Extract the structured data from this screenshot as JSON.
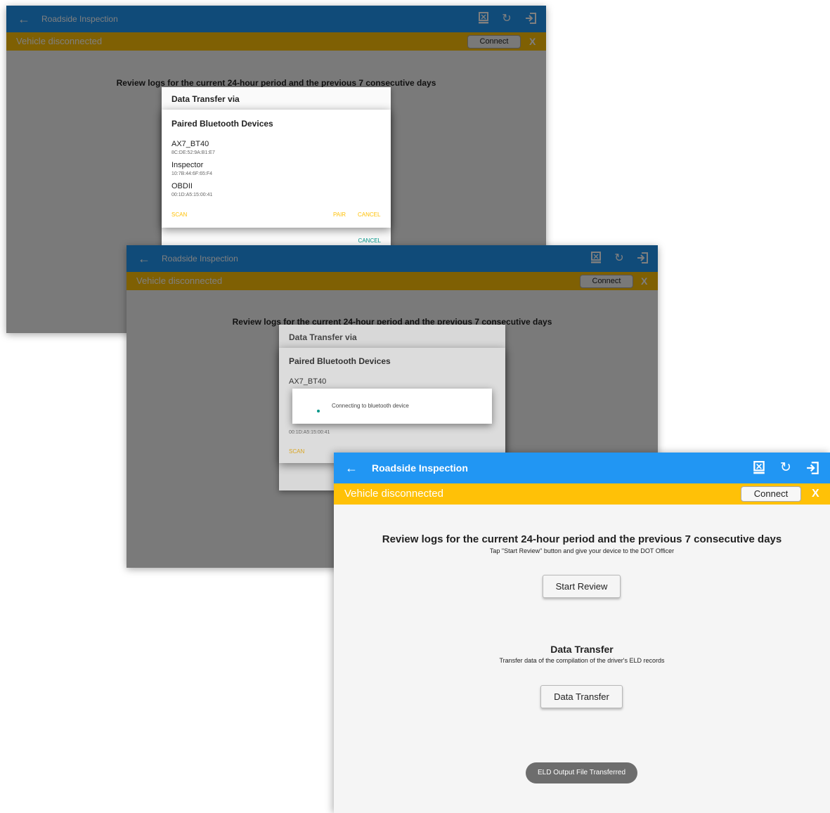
{
  "app": {
    "title": "Roadside Inspection",
    "back_icon": "←",
    "status": "Vehicle disconnected",
    "connect_label": "Connect",
    "close_label": "X",
    "toolbar_icons": [
      "usb-device-icon",
      "refresh-icon",
      "logout-icon"
    ]
  },
  "review": {
    "heading": "Review logs for the current 24-hour period and the previous 7 consecutive days",
    "heading_obscured_s1": "Review logs for the current 24-hour period and the previous 7 consecutive days",
    "subtitle": "Tap \"Start Review\" button and give your device to the DOT Officer",
    "button": "Start Review"
  },
  "transfer": {
    "heading": "Data Transfer",
    "subtitle": "Transfer data of the compilation of the driver's ELD records",
    "button": "Data Transfer"
  },
  "data_transfer_dialog": {
    "title": "Data Transfer via",
    "cancel": "CANCEL"
  },
  "bluetooth_popup": {
    "title": "Paired Bluetooth Devices",
    "devices": [
      {
        "name": "AX7_BT40",
        "mac": "8C:DE:52:9A:B1:E7"
      },
      {
        "name": "Inspector",
        "mac": "10:7B:44:6F:65:F4"
      },
      {
        "name": "OBDII",
        "mac": "00:1D:A5:15:00:41"
      }
    ],
    "scan": "SCAN",
    "pair": "PAIR",
    "cancel": "CANCEL"
  },
  "progress": {
    "message": "Connecting to bluetooth device"
  },
  "toast": {
    "message": "ELD Output File Transferred"
  },
  "colors": {
    "primary": "#2196f3",
    "status_bar": "#ffc107",
    "accent": "#009688"
  }
}
